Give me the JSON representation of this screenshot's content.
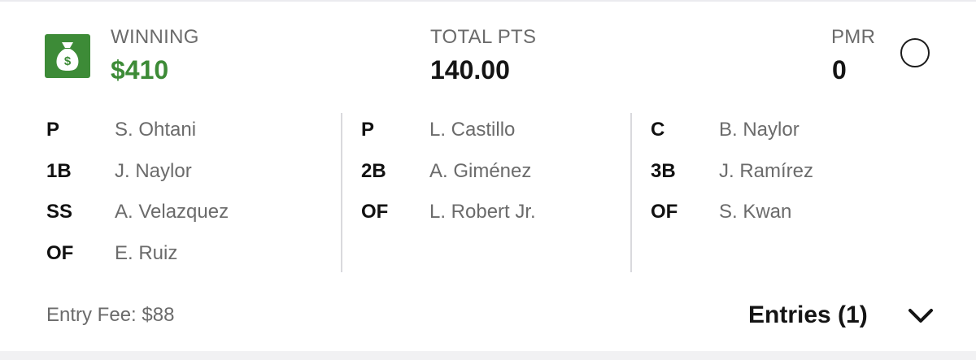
{
  "summary": {
    "winning_label": "WINNING",
    "winning_value": "$410",
    "total_pts_label": "TOTAL PTS",
    "total_pts_value": "140.00",
    "pmr_label": "PMR",
    "pmr_value": "0"
  },
  "lineup": {
    "columns": [
      [
        {
          "pos": "P",
          "player": "S. Ohtani"
        },
        {
          "pos": "1B",
          "player": "J. Naylor"
        },
        {
          "pos": "SS",
          "player": "A. Velazquez"
        },
        {
          "pos": "OF",
          "player": "E. Ruiz"
        }
      ],
      [
        {
          "pos": "P",
          "player": "L. Castillo"
        },
        {
          "pos": "2B",
          "player": "A. Giménez"
        },
        {
          "pos": "OF",
          "player": "L. Robert Jr."
        }
      ],
      [
        {
          "pos": "C",
          "player": "B. Naylor"
        },
        {
          "pos": "3B",
          "player": "J. Ramírez"
        },
        {
          "pos": "OF",
          "player": "S. Kwan"
        }
      ]
    ]
  },
  "footer": {
    "entry_fee": "Entry Fee: $88",
    "entries_label": "Entries (1)"
  },
  "icons": {
    "money": "money-bag-icon",
    "status": "circle-status-icon",
    "expand": "chevron-down-icon"
  },
  "colors": {
    "accent_green": "#3d8b37",
    "text_dark": "#141414",
    "text_muted": "#6b6b6b",
    "divider": "#d9d9dd"
  }
}
